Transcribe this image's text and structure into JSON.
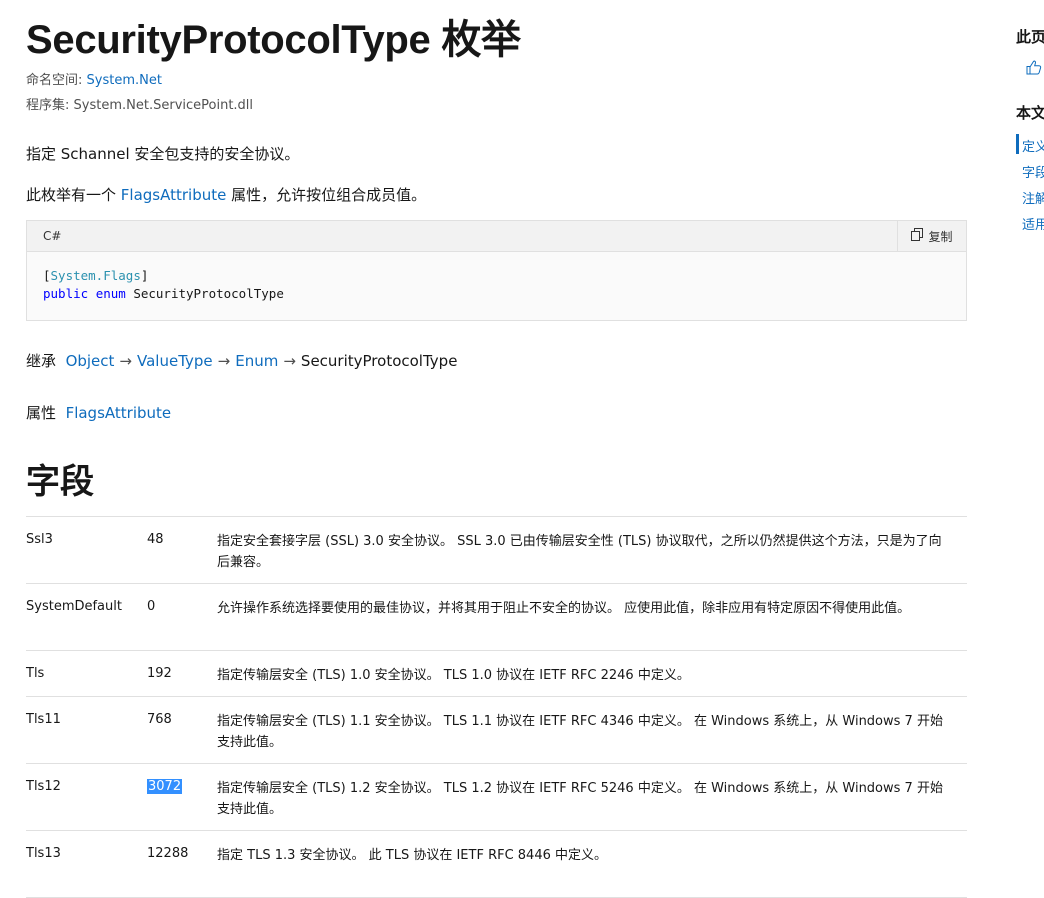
{
  "page": {
    "title": "SecurityProtocolType",
    "title_suffix": "枚举",
    "namespace_label": "命名空间:",
    "namespace_value": "System.Net",
    "assembly_label": "程序集:",
    "assembly_value": "System.Net.ServicePoint.dll",
    "summary": "指定 Schannel 安全包支持的安全协议。",
    "flags_text_before": "此枚举有一个",
    "flags_link": "FlagsAttribute",
    "flags_text_after": "属性，允许按位组合成员值。"
  },
  "code": {
    "language": "C#",
    "copy_label": "复制",
    "attr_open": "[",
    "attr_name": "System.Flags",
    "attr_close": "]",
    "kw_public": "public",
    "kw_enum": "enum",
    "type_name": "SecurityProtocolType"
  },
  "inheritance": {
    "label": "继承",
    "chain": [
      "Object",
      "ValueType",
      "Enum"
    ],
    "current": "SecurityProtocolType",
    "arrow": "→"
  },
  "attributes": {
    "label": "属性",
    "value": "FlagsAttribute"
  },
  "fields": {
    "heading": "字段",
    "rows": [
      {
        "name": "Ssl3",
        "value": "48",
        "desc": "指定安全套接字层 (SSL) 3.0 安全协议。 SSL 3.0 已由传输层安全性 (TLS) 协议取代，之所以仍然提供这个方法，只是为了向后兼容。"
      },
      {
        "name": "SystemDefault",
        "value": "0",
        "desc": "允许操作系统选择要使用的最佳协议，并将其用于阻止不安全的协议。 应使用此值，除非应用有特定原因不得使用此值。"
      },
      {
        "name": "Tls",
        "value": "192",
        "desc": "指定传输层安全 (TLS) 1.0 安全协议。 TLS 1.0 协议在 IETF RFC 2246 中定义。"
      },
      {
        "name": "Tls11",
        "value": "768",
        "desc": "指定传输层安全 (TLS) 1.1 安全协议。 TLS 1.1 协议在 IETF RFC 4346 中定义。 在 Windows 系统上，从 Windows 7 开始支持此值。"
      },
      {
        "name": "Tls12",
        "value": "3072",
        "desc": "指定传输层安全 (TLS) 1.2 安全协议。 TLS 1.2 协议在 IETF RFC 5246 中定义。 在 Windows 系统上，从 Windows 7 开始支持此值。"
      },
      {
        "name": "Tls13",
        "value": "12288",
        "desc": "指定 TLS 1.3 安全协议。 此 TLS 协议在 IETF RFC 8446 中定义。"
      }
    ]
  },
  "sidebar": {
    "head1": "此页",
    "head2": "本文",
    "items": [
      "定义",
      "字段",
      "注解",
      "适用"
    ]
  }
}
